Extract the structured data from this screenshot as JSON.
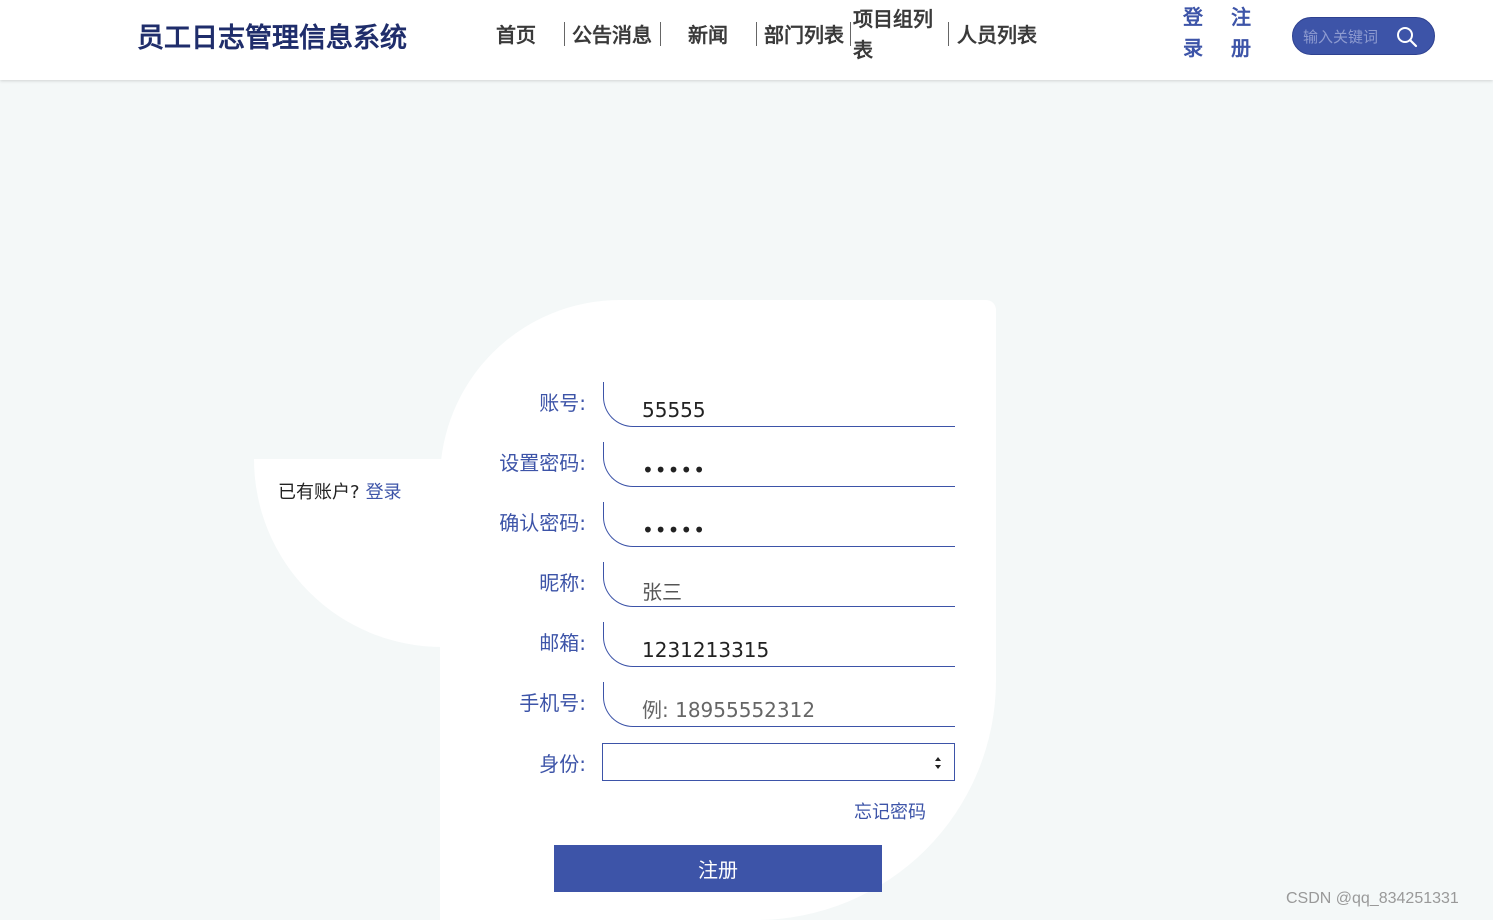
{
  "header": {
    "site_title": "员工日志管理信息系统",
    "nav": [
      "首页",
      "公告消息",
      "新闻",
      "部门列表",
      "项目组列表",
      "人员列表"
    ],
    "login": "登录",
    "register": "注册",
    "search_placeholder": "输入关键词"
  },
  "side": {
    "has_account": "已有账户?",
    "login_link": "登录"
  },
  "form": {
    "fields": [
      {
        "label": "账号:",
        "value": "55555",
        "placeholder": ""
      },
      {
        "label": "设置密码:",
        "value": "•••••",
        "placeholder": ""
      },
      {
        "label": "确认密码:",
        "value": "•••••",
        "placeholder": ""
      },
      {
        "label": "昵称:",
        "value": "张三",
        "placeholder": ""
      },
      {
        "label": "邮箱:",
        "value": "1231213315",
        "placeholder": ""
      },
      {
        "label": "手机号:",
        "value": "",
        "placeholder": "例: 18955552312"
      }
    ],
    "identity_label": "身份:",
    "identity_value": "",
    "forgot_password": "忘记密码",
    "submit": "注册"
  },
  "watermark": "CSDN @qq_834251331",
  "colors": {
    "accent": "#3d54a8",
    "title": "#1f2d6b",
    "background": "#f4f8f8"
  }
}
